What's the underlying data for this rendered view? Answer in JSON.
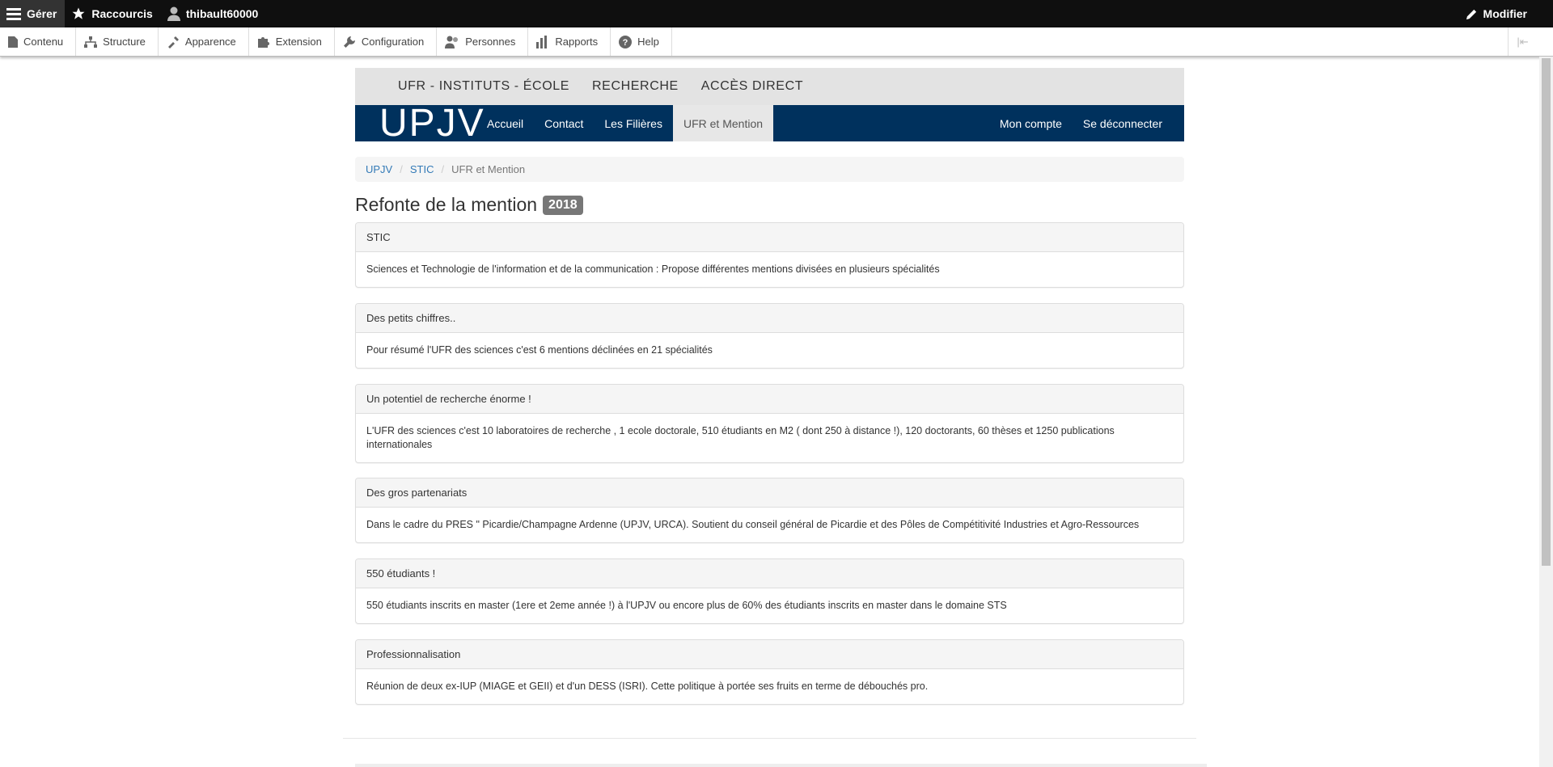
{
  "admin_bar": {
    "manage": "Gérer",
    "shortcuts": "Raccourcis",
    "user": "thibault60000",
    "edit": "Modifier"
  },
  "admin_tray": {
    "items": [
      "Contenu",
      "Structure",
      "Apparence",
      "Extension",
      "Configuration",
      "Personnes",
      "Rapports",
      "Help"
    ]
  },
  "site": {
    "top_links": [
      "UFR - INSTITUTS - ÉCOLE",
      "RECHERCHE",
      "ACCÈS DIRECT"
    ],
    "logo": "UPJV",
    "nav": [
      "Accueil",
      "Contact",
      "Les Filières",
      "UFR et Mention"
    ],
    "nav_right": [
      "Mon compte",
      "Se déconnecter"
    ],
    "colors": {
      "nav_bg": "#00315d",
      "top_bg": "#e3e3e3",
      "badge_bg": "#777777"
    }
  },
  "breadcrumb": {
    "items": [
      "UPJV",
      "STIC"
    ],
    "current": "UFR et Mention"
  },
  "page": {
    "title": "Refonte de la mention",
    "badge": "2018"
  },
  "panels": [
    {
      "title": "STIC",
      "body": "Sciences et Technologie de l'information et de la communication : Propose différentes mentions divisées en plusieurs spécialités"
    },
    {
      "title": "Des petits chiffres..",
      "body": "Pour résumé l'UFR des sciences c'est 6 mentions déclinées en 21 spécialités"
    },
    {
      "title": "Un potentiel de recherche énorme !",
      "body": "L'UFR des sciences c'est 10 laboratoires de recherche , 1 ecole doctorale, 510 étudiants en M2 ( dont 250 à distance !), 120 doctorants, 60 thèses et 1250 publications internationales"
    },
    {
      "title": "Des gros partenariats",
      "body": "Dans le cadre du PRES \" Picardie/Champagne Ardenne (UPJV, URCA). Soutient du conseil général de Picardie et des Pôles de Compétitivité Industries et Agro-Ressources"
    },
    {
      "title": "550 étudiants !",
      "body": "550 étudiants inscrits en master (1ere et 2eme année !) à l'UPJV ou encore plus de 60% des étudiants inscrits en master dans le domaine STS"
    },
    {
      "title": "Professionnalisation",
      "body": "Réunion de deux ex-IUP (MIAGE et GEII) et d'un DESS (ISRI). Cette politique à portée ses fruits en terme de débouchés pro."
    }
  ]
}
